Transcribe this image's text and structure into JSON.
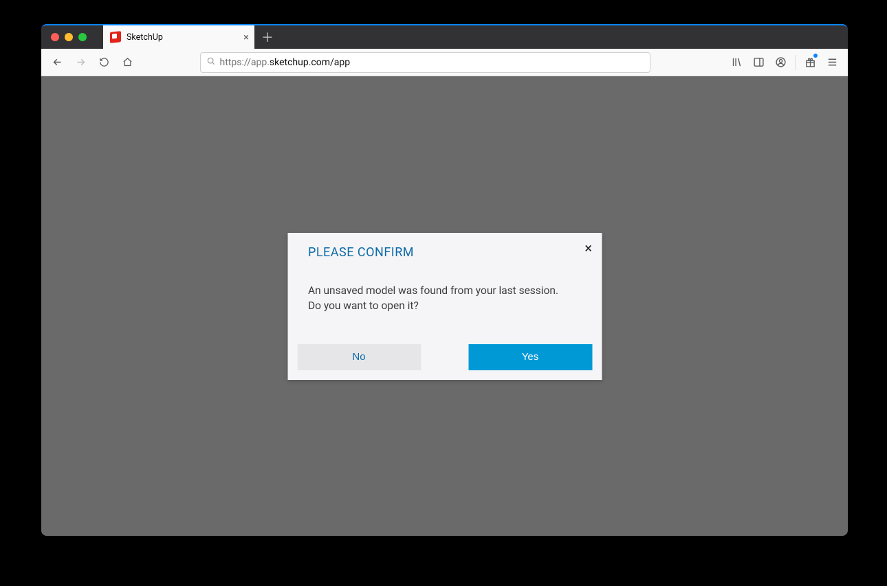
{
  "browser": {
    "tab": {
      "title": "SketchUp"
    },
    "url": {
      "scheme": "https://",
      "subdomain": "app.",
      "host": "sketchup.com",
      "path": "/app"
    }
  },
  "dialog": {
    "title": "PLEASE CONFIRM",
    "message_line1": "An unsaved model was found from your last session.",
    "message_line2": "Do you want to open it?",
    "no_label": "No",
    "yes_label": "Yes"
  }
}
